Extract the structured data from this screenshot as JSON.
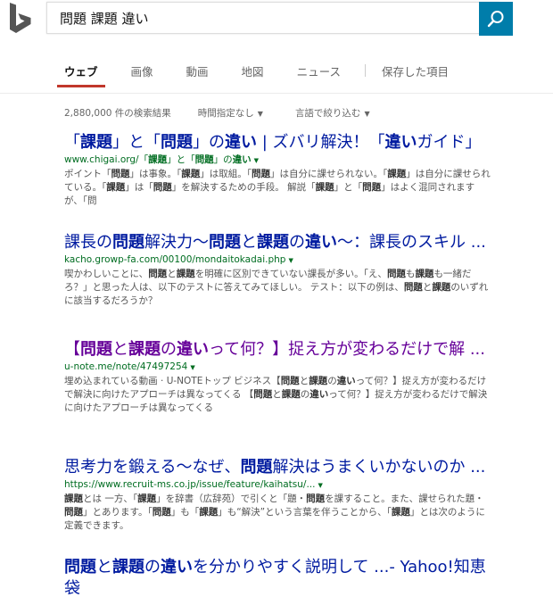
{
  "query": "問題 課題 違い",
  "colors": {
    "brand_blue": "#007daa",
    "tab_underline": "#c1372b",
    "link": "#001ba0",
    "visited": "#660099",
    "url": "#006d21"
  },
  "tabs": [
    {
      "label": "ウェブ",
      "active": true
    },
    {
      "label": "画像"
    },
    {
      "label": "動画"
    },
    {
      "label": "地図"
    },
    {
      "label": "ニュース"
    },
    {
      "label": "保存した項目"
    }
  ],
  "meta": {
    "result_count": "2,880,000 件の検索結果",
    "time_filter": "時間指定なし",
    "language_filter": "言語で絞り込む"
  },
  "results": [
    {
      "title": [
        [
          "「",
          0
        ],
        [
          "課題",
          1
        ],
        [
          "」と「",
          0
        ],
        [
          "問題",
          1
        ],
        [
          "」の",
          0
        ],
        [
          "違い",
          1
        ],
        [
          " | ズバリ解決！「",
          0
        ],
        [
          "違い",
          1
        ],
        [
          "ガイド」",
          0
        ]
      ],
      "url": [
        [
          "www.chigai.org/「",
          0
        ],
        [
          "課題",
          1
        ],
        [
          "」と「",
          0
        ],
        [
          "問題",
          1
        ],
        [
          "」の",
          0
        ],
        [
          "違い",
          1
        ]
      ],
      "snippet": [
        [
          "ポイント「",
          0
        ],
        [
          "問題",
          1
        ],
        [
          "」は事象。「",
          0
        ],
        [
          "課題",
          1
        ],
        [
          "」は取組。「",
          0
        ],
        [
          "問題",
          1
        ],
        [
          "」は自分に課せられない。「",
          0
        ],
        [
          "課題",
          1
        ],
        [
          "」は自分に課せられている。「",
          0
        ],
        [
          "課題",
          1
        ],
        [
          "」は「",
          0
        ],
        [
          "問題",
          1
        ],
        [
          "」を解決するための手段。 解説「",
          0
        ],
        [
          "課題",
          1
        ],
        [
          "」と「",
          0
        ],
        [
          "問題",
          1
        ],
        [
          "」はよく混同されますが、「問",
          0
        ]
      ]
    },
    {
      "title": [
        [
          "課長の",
          0
        ],
        [
          "問題",
          1
        ],
        [
          "解決力～",
          0
        ],
        [
          "問題",
          1
        ],
        [
          "と",
          0
        ],
        [
          "課題",
          1
        ],
        [
          "の",
          0
        ],
        [
          "違い",
          1
        ],
        [
          "～：課長のスキル ...",
          0
        ]
      ],
      "url": [
        [
          "kacho.growp-fa.com/00100/mondaitokadai.php",
          0
        ]
      ],
      "snippet": [
        [
          "喫かわしいことに、",
          0
        ],
        [
          "問題",
          1
        ],
        [
          "と",
          0
        ],
        [
          "課題",
          1
        ],
        [
          "を明確に区別できていない課長が多い。「え、",
          0
        ],
        [
          "問題",
          1
        ],
        [
          "も",
          0
        ],
        [
          "課題",
          1
        ],
        [
          "も一緒だろ？」と思った人は、以下のテストに答えてみてほしい。 テスト：以下の例は、",
          0
        ],
        [
          "問題",
          1
        ],
        [
          "と",
          0
        ],
        [
          "課題",
          1
        ],
        [
          "のいずれに該当するだろうか？",
          0
        ]
      ]
    },
    {
      "title": [
        [
          "【",
          0
        ],
        [
          "問題",
          1
        ],
        [
          "と",
          0
        ],
        [
          "課題",
          1
        ],
        [
          "の",
          0
        ],
        [
          "違い",
          1
        ],
        [
          "って何？】捉え方が変わるだけで解 ...",
          0
        ]
      ],
      "url": [
        [
          "u-note.me/note/47497254",
          0
        ]
      ],
      "snippet": [
        [
          "埋め込まれている動画 · U-NOTEトップ ビジネス【",
          0
        ],
        [
          "問題",
          1
        ],
        [
          "と",
          0
        ],
        [
          "課題",
          1
        ],
        [
          "の",
          0
        ],
        [
          "違い",
          1
        ],
        [
          "って何？】捉え方が変わるだけで解決に向けたアプローチは異なってくる 【",
          0
        ],
        [
          "問題",
          1
        ],
        [
          "と",
          0
        ],
        [
          "課題",
          1
        ],
        [
          "の",
          0
        ],
        [
          "違い",
          1
        ],
        [
          "って何？】捉え方が変わるだけで解決に向けたアプローチは異なってくる",
          0
        ]
      ]
    },
    {
      "title": [
        [
          "思考力を鍛える～なぜ、",
          0
        ],
        [
          "問題",
          1
        ],
        [
          "解決はうまくいかないのか ...",
          0
        ]
      ],
      "url": [
        [
          "https://www.recruit-ms.co.jp/issue/feature/kaihatsu/...",
          0
        ]
      ],
      "snippet": [
        [
          "課題",
          1
        ],
        [
          "とは 一方、「",
          0
        ],
        [
          "課題",
          1
        ],
        [
          "」を辞書（広辞苑）で引くと「題・",
          0
        ],
        [
          "問題",
          1
        ],
        [
          "を課すること。また、課せられた題・",
          0
        ],
        [
          "問題",
          1
        ],
        [
          "」とあります。「",
          0
        ],
        [
          "問題",
          1
        ],
        [
          "」も「",
          0
        ],
        [
          "課題",
          1
        ],
        [
          "」も“解決”という言葉を伴うことから、「",
          0
        ],
        [
          "課題",
          1
        ],
        [
          "」とは次のように定義できます。",
          0
        ]
      ]
    },
    {
      "title": [
        [
          "問題",
          1
        ],
        [
          "と",
          0
        ],
        [
          "課題",
          1
        ],
        [
          "の",
          0
        ],
        [
          "違い",
          1
        ],
        [
          "を分かりやすく説明して ...- Yahoo!知恵袋",
          0
        ]
      ],
      "url": [],
      "snippet": []
    }
  ]
}
